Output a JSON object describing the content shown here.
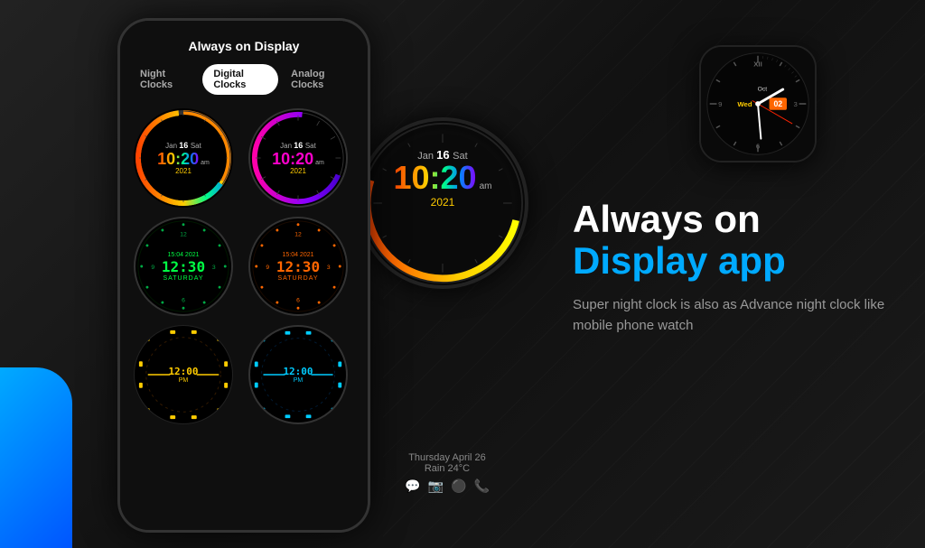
{
  "app": {
    "title": "Always on Display app",
    "headline_1": "Always on",
    "headline_2": "Display app",
    "subtitle": "Super night clock is also as Advance night clock like mobile phone watch"
  },
  "phone": {
    "header": "Always on Display",
    "tabs": [
      {
        "label": "Night Clocks",
        "active": false
      },
      {
        "label": "Digital Clocks",
        "active": true
      },
      {
        "label": "Analog Clocks",
        "active": false
      }
    ]
  },
  "clocks": [
    {
      "date": "Jan 16 Sat",
      "time": "10:20",
      "ampm": "am",
      "year": "2021",
      "color": "rainbow"
    },
    {
      "date": "Jan 16 Sat",
      "time": "10:20",
      "ampm": "am",
      "year": "2021",
      "color": "pink"
    },
    {
      "top": "15:04 2021",
      "time": "12:30",
      "bottom": "SATURDAY",
      "color": "green"
    },
    {
      "top": "15:04 2021",
      "time": "12:30",
      "bottom": "SATURDAY",
      "color": "orange"
    },
    {
      "time": "12:00",
      "label": "PM",
      "color": "yellow"
    },
    {
      "time": "12:00",
      "label": "PM",
      "color": "cyan"
    }
  ],
  "big_watch": {
    "date": "Jan 16 Sat",
    "time": "10:20",
    "ampm": "am",
    "year": "2021",
    "status_date": "Thursday April 26",
    "weather": "Rain 24°C"
  },
  "analog_watch": {
    "day": "Wed",
    "month": "Oct",
    "date": "02"
  },
  "icons": {
    "wechat": "💬",
    "camera": "📷",
    "circle": "⚫",
    "phone": "📞"
  }
}
